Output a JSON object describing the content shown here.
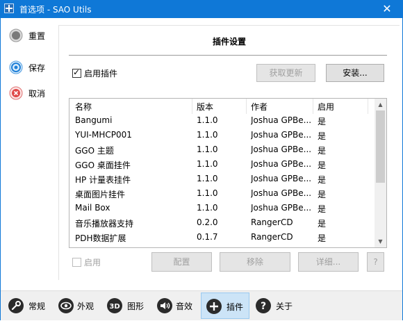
{
  "window": {
    "title": "首选项 - SAO Utils",
    "close_glyph": "✕"
  },
  "side_actions": [
    {
      "label": "重置",
      "icon": "reset-icon"
    },
    {
      "label": "保存",
      "icon": "save-icon"
    },
    {
      "label": "取消",
      "icon": "cancel-icon"
    }
  ],
  "panel": {
    "heading": "插件设置",
    "enable_plugins_label": "启用插件",
    "enable_plugins_checked": true,
    "get_updates_label": "获取更新",
    "install_label": "安装...",
    "columns": {
      "name": "名称",
      "version": "版本",
      "author": "作者",
      "enabled": "启用"
    },
    "plugins": [
      {
        "name": "Bangumi",
        "version": "1.1.0",
        "author": "Joshua GPBe...",
        "enabled": "是"
      },
      {
        "name": "YUI-MHCP001",
        "version": "1.1.0",
        "author": "Joshua GPBe...",
        "enabled": "是"
      },
      {
        "name": "GGO 主题",
        "version": "1.1.0",
        "author": "Joshua GPBe...",
        "enabled": "是"
      },
      {
        "name": "GGO 桌面挂件",
        "version": "1.1.0",
        "author": "Joshua GPBe...",
        "enabled": "是"
      },
      {
        "name": "HP 计量表挂件",
        "version": "1.1.0",
        "author": "Joshua GPBe...",
        "enabled": "是"
      },
      {
        "name": "桌面图片挂件",
        "version": "1.1.0",
        "author": "Joshua GPBe...",
        "enabled": "是"
      },
      {
        "name": "Mail Box",
        "version": "1.1.0",
        "author": "Joshua GPBe...",
        "enabled": "是"
      },
      {
        "name": "音乐播放器支持",
        "version": "0.2.0",
        "author": "RangerCD",
        "enabled": "是"
      },
      {
        "name": "PDH数据扩展",
        "version": "0.1.7",
        "author": "RangerCD",
        "enabled": "是"
      }
    ],
    "enable_selected_label": "启用",
    "configure_label": "配置",
    "remove_label": "移除",
    "details_label": "详细...",
    "help_label": "?"
  },
  "tabs": [
    {
      "label": "常规",
      "icon": "wrench-icon"
    },
    {
      "label": "外观",
      "icon": "eye-icon"
    },
    {
      "label": "图形",
      "icon": "3d-icon"
    },
    {
      "label": "音效",
      "icon": "speaker-icon"
    },
    {
      "label": "插件",
      "icon": "plus-icon",
      "active": true
    },
    {
      "label": "关于",
      "icon": "question-icon"
    }
  ],
  "colors": {
    "titlebar": "#0f78d7",
    "active_tab": "#cce4f7",
    "tab_icon": "#2b2b2b"
  }
}
